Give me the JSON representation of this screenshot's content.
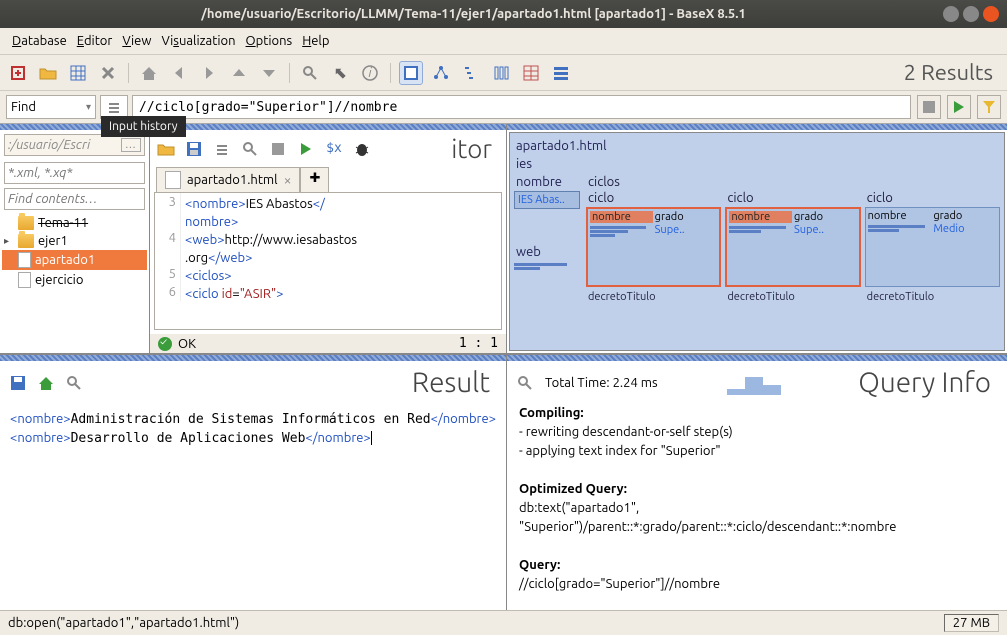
{
  "window": {
    "title": "/home/usuario/Escritorio/LLMM/Tema-11/ejer1/apartado1.html [apartado1] - BaseX 8.5.1"
  },
  "menu": {
    "database": "Database",
    "editor": "Editor",
    "view": "View",
    "visualization": "Visualization",
    "options": "Options",
    "help": "Help"
  },
  "results_count": "2 Results",
  "querybar": {
    "find_label": "Find",
    "tooltip": "Input history",
    "query": "//ciclo[grado=\"Superior\"]//nombre"
  },
  "leftpane": {
    "path_value": ":/usuario/Escri",
    "filter_placeholder": "*.xml, *.xq*",
    "find_placeholder": "Find contents…",
    "tree": {
      "parent": "Tema-11",
      "folder": "ejer1",
      "file1": "apartado1",
      "file2": "ejercicio"
    }
  },
  "editor": {
    "heading": "itor",
    "tab": "apartado1.html",
    "lines": [
      "3",
      "4",
      "5",
      "6"
    ],
    "code_html": "  <span class='tag'>&lt;nombre&gt;</span>IES Abastos<span class='tag'>&lt;/</span><br><span class='tag'>nombre&gt;</span><br>  <span class='tag'>&lt;web&gt;</span>http://www.iesabastos<br>.org<span class='tag'>&lt;/web&gt;</span><br>  <span class='tag'>&lt;ciclos&gt;</span><br>    <span class='tag'>&lt;ciclo</span> <span class='attr'>id</span>=<span class='str'>\"ASIR\"</span><span class='tag'>&gt;</span>",
    "status_ok": "OK",
    "status_pos": "1 : 1"
  },
  "viz": {
    "file": "apartado1.html",
    "root": "ies",
    "nombre_label": "nombre",
    "nombre_val": "IES Abas..",
    "web_label": "web",
    "ciclos_label": "ciclos",
    "ciclo_label": "ciclo",
    "col_nombre": "nombre",
    "col_grado": "grado",
    "grado_sup": "Supe..",
    "grado_med": "Medio",
    "decreto": "decretoTitulo"
  },
  "result": {
    "heading": "Result",
    "body_html": "<span class='tag'>&lt;nombre&gt;</span>Administración de Sistemas Informáticos en Red<span class='tag'>&lt;/nombre&gt;</span><br><span class='tag'>&lt;nombre&gt;</span>Desarrollo de Aplicaciones Web<span class='tag'>&lt;/nombre&gt;</span><span class='cursor'></span>"
  },
  "queryinfo": {
    "heading": "Query Info",
    "total_time": "Total Time: 2.24 ms",
    "compiling_h": "Compiling:",
    "compiling_1": "- rewriting descendant-or-self step(s)",
    "compiling_2": "- applying text index for \"Superior\"",
    "optimized_h": "Optimized Query:",
    "optimized": "db:text(\"apartado1\", \"Superior\")/parent::*:grado/parent::*:ciclo/descendant::*:nombre",
    "query_h": "Query:",
    "query": "//ciclo[grado=\"Superior\"]//nombre"
  },
  "footer": {
    "text": "db:open(\"apartado1\",\"apartado1.html\")",
    "mem": "27 MB"
  }
}
